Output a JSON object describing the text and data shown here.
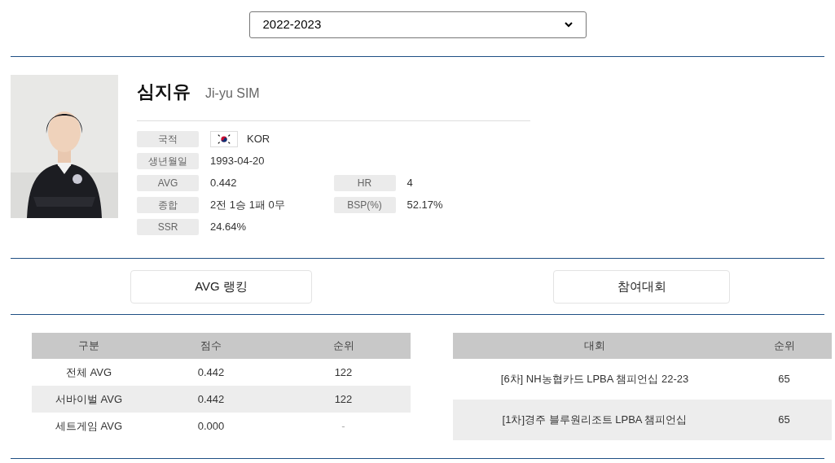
{
  "season_select": {
    "value": "2022-2023"
  },
  "player": {
    "name": "심지유",
    "name_en": "Ji-yu SIM",
    "info": [
      [
        {
          "label": "국적",
          "value": "KOR",
          "kind": "flag"
        }
      ],
      [
        {
          "label": "생년월일",
          "value": "1993-04-20",
          "kind": "text"
        }
      ],
      [
        {
          "label": "AVG",
          "value": "0.442",
          "kind": "text"
        },
        {
          "label": "HR",
          "value": "4",
          "kind": "text"
        }
      ],
      [
        {
          "label": "종합",
          "value": "2전 1승 1패 0무",
          "kind": "text"
        },
        {
          "label": "BSP(%)",
          "value": "52.17%",
          "kind": "text"
        }
      ],
      [
        {
          "label": "SSR",
          "value": "24.64%",
          "kind": "text"
        }
      ]
    ]
  },
  "section_buttons": [
    "AVG 랭킹",
    "참여대회"
  ],
  "avg_table": {
    "columns": [
      "구분",
      "점수",
      "순위"
    ],
    "rows": [
      [
        "전체 AVG",
        "0.442",
        "122"
      ],
      [
        "서바이벌 AVG",
        "0.442",
        "122"
      ],
      [
        "세트게임 AVG",
        "0.000",
        "-"
      ]
    ]
  },
  "tournament_table": {
    "columns": [
      "대회",
      "순위"
    ],
    "rows": [
      [
        "[6차] NH농협카드 LPBA 챔피언십 22-23",
        "65"
      ],
      [
        "[1차]경주 블루원리조트 LPBA 챔피언십",
        "65"
      ]
    ]
  }
}
